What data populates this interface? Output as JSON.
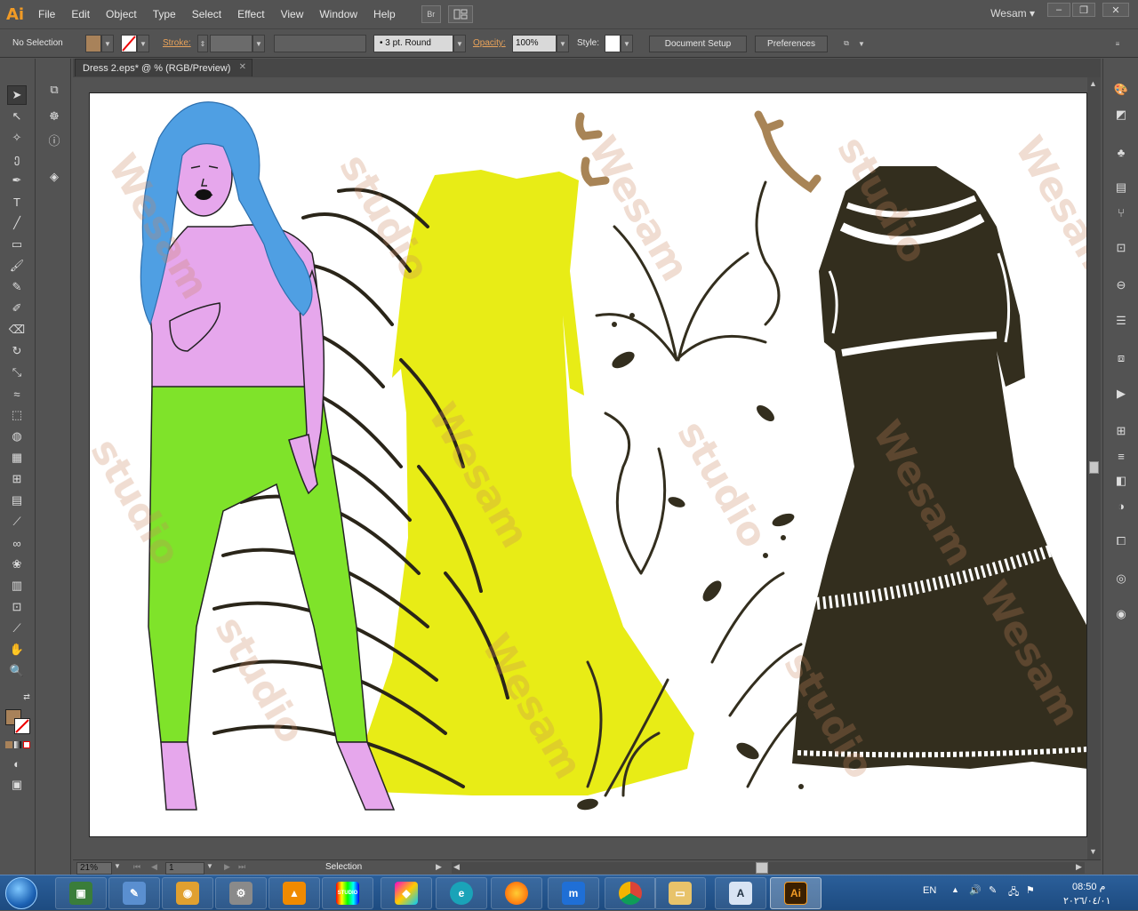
{
  "app": {
    "logo": "Ai",
    "menu": [
      "File",
      "Edit",
      "Object",
      "Type",
      "Select",
      "Effect",
      "View",
      "Window",
      "Help"
    ],
    "bridge_label": "Br",
    "workspace": "Wesam"
  },
  "control_bar": {
    "selection": "No Selection",
    "stroke_label": "Stroke:",
    "brush": "3 pt. Round",
    "opacity_label": "Opacity:",
    "opacity_value": "100%",
    "style_label": "Style:",
    "document_setup": "Document Setup",
    "preferences": "Preferences"
  },
  "document": {
    "tab_title": "Dress 2.eps* @ % (RGB/Preview)",
    "watermark": "Wesam studio"
  },
  "status_bar": {
    "zoom": "21%",
    "artboard": "1",
    "tool_status": "Selection"
  },
  "taskbar": {
    "language": "EN",
    "time": "08:50 م",
    "date": "٢٠٢٦/٠٤/٠١",
    "studio_label": "STUDIO"
  },
  "colors": {
    "ui_gray": "#535353",
    "hair": "#4f9fe3",
    "skin": "#e6a7ec",
    "pants": "#7fe32a",
    "dress_yellow": "#e8ec16",
    "dress_dark": "#332e1e",
    "shoe_tan": "#a88456"
  }
}
